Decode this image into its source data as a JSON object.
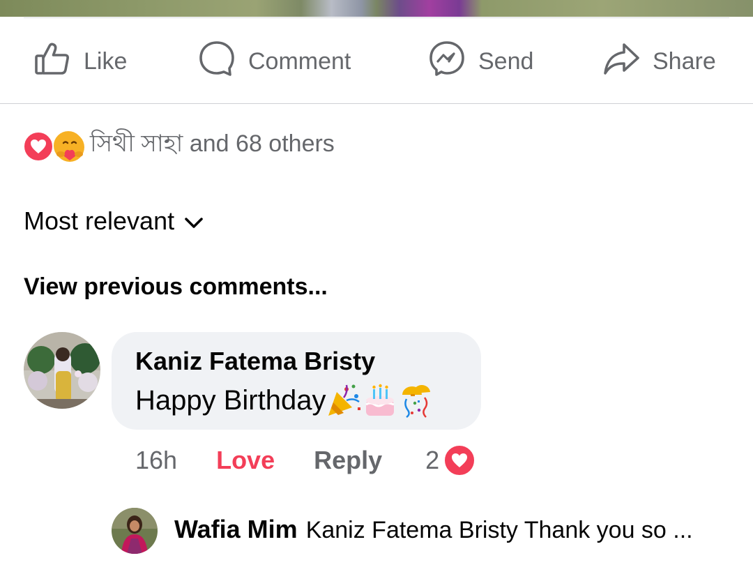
{
  "actions": {
    "like": "Like",
    "comment": "Comment",
    "send": "Send",
    "share": "Share"
  },
  "reactions": {
    "summary": "সিথী সাহা and 68 others",
    "icons": [
      "love-reaction-icon",
      "care-reaction-icon"
    ]
  },
  "sort": {
    "label": "Most relevant"
  },
  "view_previous": "View previous comments...",
  "comment": {
    "author": "Kaniz Fatema Bristy",
    "text": "Happy Birthday",
    "emojis": [
      "party-popper-icon",
      "birthday-cake-icon",
      "confetti-ball-icon"
    ],
    "time": "16h",
    "reaction_label": "Love",
    "reply_label": "Reply",
    "reaction_count": "2"
  },
  "reply": {
    "author": "Wafia Mim",
    "text": "Kaniz Fatema Bristy Thank you  so ..."
  },
  "colors": {
    "love": "#f33e58",
    "secondary_text": "#65676b",
    "bubble": "#f0f2f5"
  }
}
